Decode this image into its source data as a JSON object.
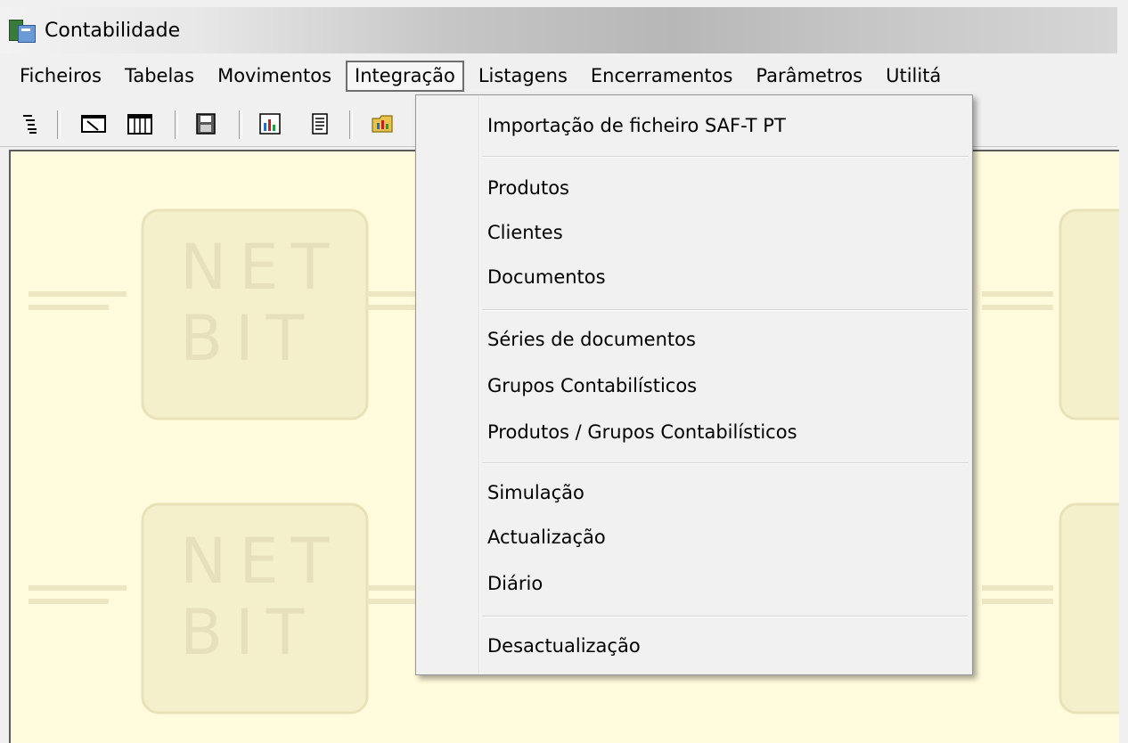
{
  "window": {
    "title": "Contabilidade",
    "icon": "app-icon"
  },
  "menubar": {
    "items": [
      {
        "label": "Ficheiros"
      },
      {
        "label": "Tabelas"
      },
      {
        "label": "Movimentos"
      },
      {
        "label": "Integração",
        "active": true
      },
      {
        "label": "Listagens"
      },
      {
        "label": "Encerramentos"
      },
      {
        "label": "Parâmetros"
      },
      {
        "label": "Utilitá"
      }
    ]
  },
  "toolbar": {
    "icons": [
      "tree-list-icon",
      "edit-window-icon",
      "calendar-table-icon",
      "disk-form-icon",
      "chart-report-icon",
      "document-icon",
      "folder-chart-icon"
    ]
  },
  "workspace": {
    "background": "#fffbdc",
    "watermark": {
      "line1": "NET",
      "line2": "BIT",
      "side": "01"
    }
  },
  "integracao_menu": {
    "items": [
      "Importação de ficheiro SAF-T PT",
      "Produtos",
      "Clientes",
      "Documentos",
      "Séries de documentos",
      "Grupos Contabilísticos",
      "Produtos / Grupos Contabilísticos",
      "Simulação",
      "Actualização",
      "Diário",
      "Desactualização"
    ]
  }
}
